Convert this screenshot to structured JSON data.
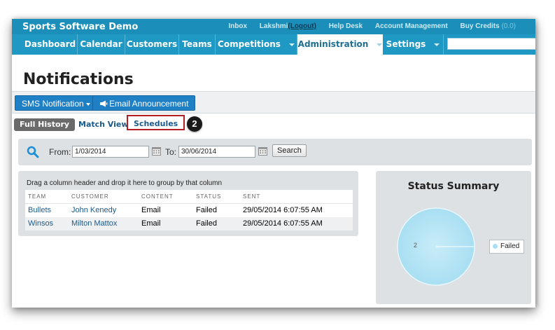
{
  "app": {
    "brand": "Sports Software Demo",
    "top_links": {
      "inbox": "Inbox",
      "user": "Lakshmi",
      "logout": "(Logout)",
      "help": "Help Desk",
      "account": "Account Management",
      "credits_label": "Buy Credits",
      "credits_value": "(0.0)"
    }
  },
  "nav": {
    "items": [
      {
        "label": "Dashboard"
      },
      {
        "label": "Calendar"
      },
      {
        "label": "Customers"
      },
      {
        "label": "Teams"
      },
      {
        "label": "Competitions"
      },
      {
        "label": "Administration"
      },
      {
        "label": "Settings"
      }
    ],
    "active": "Administration"
  },
  "page": {
    "title": "Notifications"
  },
  "toolbar": {
    "sms_label": "SMS Notification",
    "email_label": "Email Announcement"
  },
  "tabs": [
    {
      "label": "Full History",
      "style": "dark"
    },
    {
      "label": "Match View",
      "style": "link"
    },
    {
      "label": "Schedules",
      "style": "highlighted"
    }
  ],
  "callout_number": "2",
  "filter": {
    "from_label": "From:",
    "from_value": "1/03/2014",
    "to_label": "To:",
    "to_value": "30/06/2014",
    "search_label": "Search"
  },
  "grid": {
    "drag_hint": "Drag a column header and drop it here to group by that column",
    "columns": [
      "TEAM",
      "CUSTOMER",
      "CONTENT",
      "STATUS",
      "SENT"
    ],
    "rows": [
      [
        "Bullets",
        "John Kenedy",
        "Email",
        "Failed",
        "29/05/2014 6:07:55 AM"
      ],
      [
        "Winsos",
        "Milton Mattox",
        "Email",
        "Failed",
        "29/05/2014 6:07:55 AM"
      ]
    ]
  },
  "status_summary": {
    "title": "Status Summary",
    "slice_label": "2",
    "legend": "Failed",
    "colors": {
      "pie": "#a8dff2",
      "pie_edge": "#e8f7fc"
    }
  },
  "colors": {
    "topbar": "#1b8fb9",
    "navbar": "#1f98c4",
    "button_blue": "#1f80c6",
    "highlight_box": "#b41e22",
    "panel_gray": "#dde1e4"
  }
}
